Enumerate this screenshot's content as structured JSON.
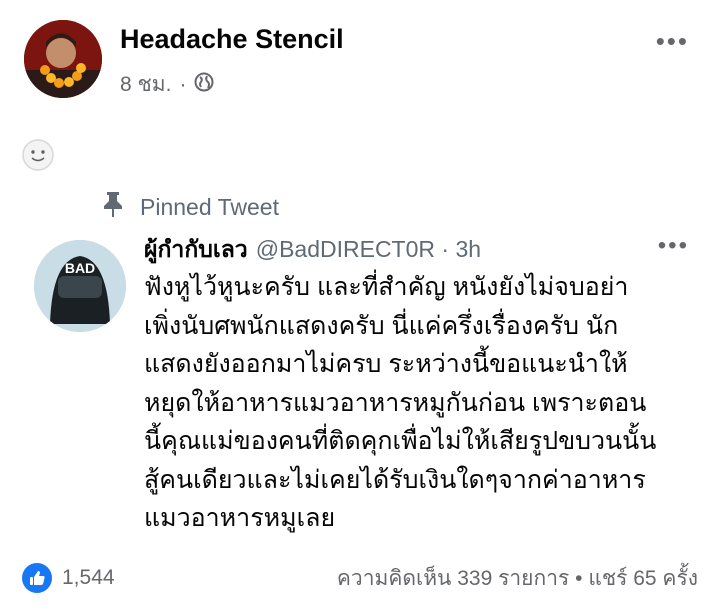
{
  "post": {
    "author": "Headache Stencil",
    "time": "8 ชม.",
    "separator": "·",
    "privacy_icon": "globe-icon",
    "more": "•••"
  },
  "tweet": {
    "pinned_label": "Pinned Tweet",
    "display_name": "ผู้กำกับเลว",
    "handle": "@BadDIRECT0R",
    "time": "· 3h",
    "avatar_text": "BAD",
    "more": "•••",
    "lines": [
      "ฟังหูไว้หูนะครับ และที่สำคัญ หนังยังไม่จบอย่า",
      "เพิ่งนับศพนักแสดงครับ นี่แค่ครึ่งเรื่องครับ นัก",
      "แสดงยังออกมาไม่ครบ ระหว่างนี้ขอแนะนำให้",
      "หยุดให้อาหารแมวอาหารหมูกันก่อน เพราะตอน",
      "นี้คุณแม่ของคนที่ติดคุกเพื่อไม่ให้เสียรูปขบวนนั้น",
      "สู้คนเดียวและไม่เคยได้รับเงินใดๆจากค่าอาหาร",
      "แมวอาหารหมูเลย"
    ]
  },
  "footer": {
    "like_count": "1,544",
    "comments": "ความคิดเห็น 339 รายการ",
    "sep": "•",
    "shares": "แชร์ 65 ครั้ง"
  },
  "colors": {
    "like_blue": "#1877f2",
    "muted": "#65676b",
    "tweet_muted": "#5f6a74"
  }
}
